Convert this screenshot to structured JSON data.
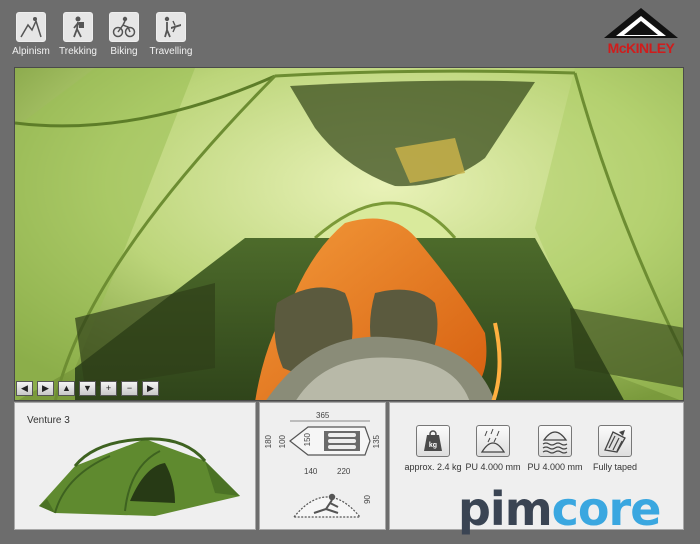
{
  "activities": [
    {
      "label": "Alpinism",
      "icon": "alpinism-icon"
    },
    {
      "label": "Trekking",
      "icon": "trekking-icon"
    },
    {
      "label": "Biking",
      "icon": "biking-icon"
    },
    {
      "label": "Travelling",
      "icon": "travelling-icon"
    }
  ],
  "brand": {
    "name": "McKINLEY",
    "accent": "#d01c1c"
  },
  "viewer_controls": [
    {
      "name": "pan-left-button",
      "glyph": "◀"
    },
    {
      "name": "pan-right-button",
      "glyph": "▶"
    },
    {
      "name": "pan-up-button",
      "glyph": "▲"
    },
    {
      "name": "pan-down-button",
      "glyph": "▼"
    },
    {
      "name": "zoom-in-button",
      "glyph": "+"
    },
    {
      "name": "zoom-out-button",
      "glyph": "−"
    },
    {
      "name": "play-button",
      "glyph": "▶"
    }
  ],
  "product": {
    "model": "Venture 3"
  },
  "dimensions": {
    "length_total": "365",
    "width_outer": "180",
    "width_inner": "100",
    "inner_width_center": "150",
    "width_right": "135",
    "vestibule": "140",
    "inner_length": "220",
    "height": "90"
  },
  "features": [
    {
      "label": "approx. 2.4 kg",
      "icon": "weight-icon",
      "glyph": "kg"
    },
    {
      "label": "PU 4.000 mm",
      "icon": "waterproof-fly-icon"
    },
    {
      "label": "PU 4.000 mm",
      "icon": "waterproof-floor-icon"
    },
    {
      "label": "Fully taped",
      "icon": "taped-seams-icon"
    }
  ],
  "footer_logo": {
    "pim": "pim",
    "core": "core"
  }
}
